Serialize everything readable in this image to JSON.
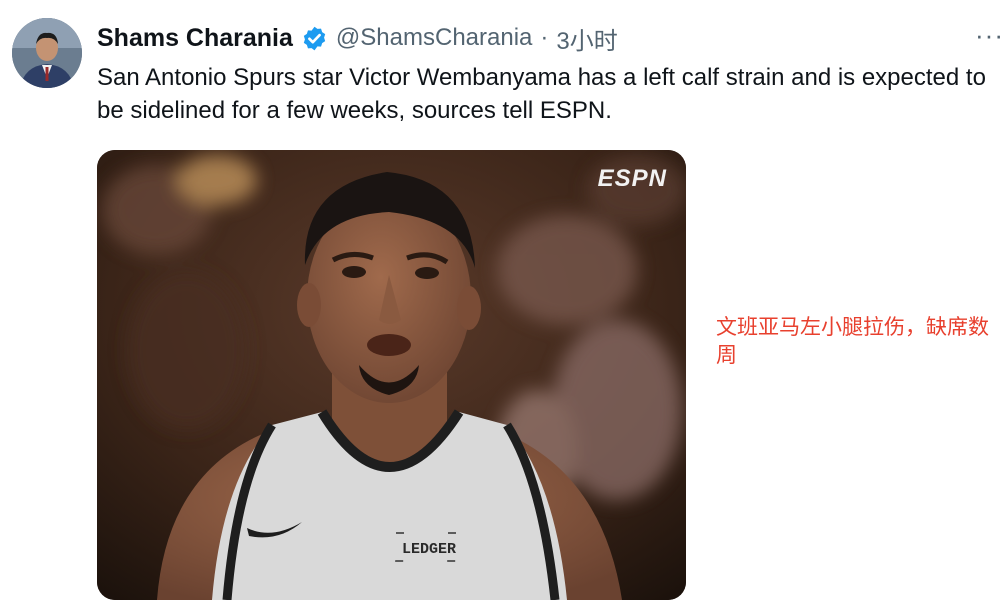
{
  "tweet": {
    "author_name": "Shams Charania",
    "handle": "@ShamsCharania",
    "separator": "·",
    "time": "3小时",
    "more_label": "···",
    "text": "San Antonio Spurs star Victor Wembanyama has a left calf strain and is expected to be sidelined for a few weeks, sources tell ESPN.",
    "verified_icon": "verified-badge-icon",
    "verified_color": "#1d9bf0",
    "media": {
      "brand": "ESPN",
      "jersey_sponsor": "LEDGER"
    }
  },
  "annotation": {
    "caption": "文班亚马左小腿拉伤，缺席数周",
    "color": "#e8402e"
  }
}
